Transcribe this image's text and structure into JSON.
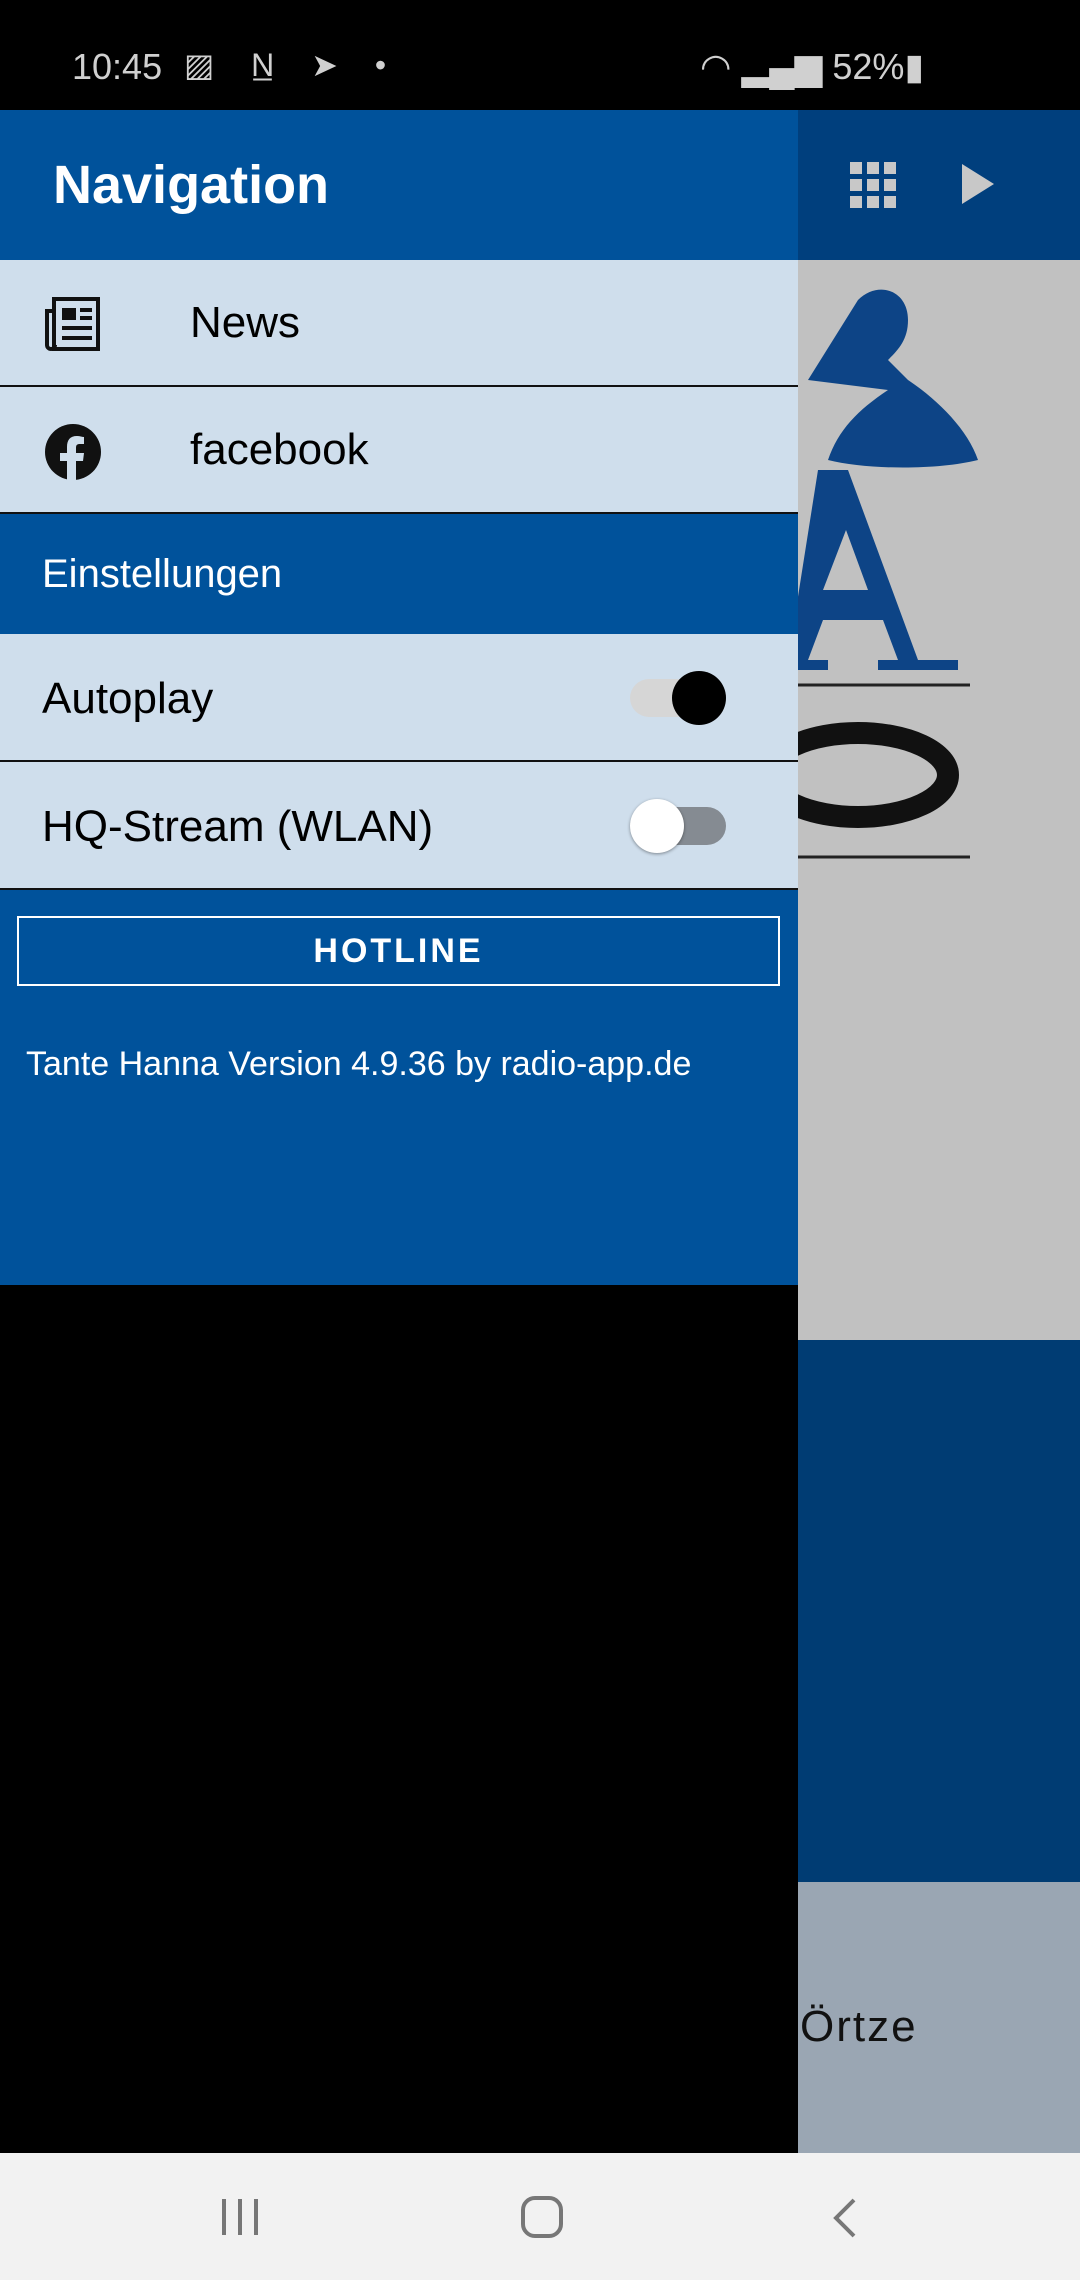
{
  "status_bar": {
    "time": "10:45",
    "notification_icons": [
      "image-icon",
      "notion-icon",
      "telegram-icon",
      "dot-icon"
    ],
    "battery": "52%"
  },
  "app_bar": {
    "icons": [
      "grid-icon",
      "play-icon"
    ]
  },
  "drawer": {
    "title": "Navigation",
    "items": [
      {
        "label": "News",
        "icon": "newspaper-icon"
      },
      {
        "label": "facebook",
        "icon": "facebook-icon"
      }
    ],
    "settings_header": "Einstellungen",
    "settings": [
      {
        "label": "Autoplay",
        "on": true
      },
      {
        "label": "HQ-Stream (WLAN)",
        "on": false
      }
    ],
    "hotline_label": "HOTLINE",
    "version_text": "Tante Hanna Version 4.9.36 by radio-app.de",
    "accent": "#00529b"
  },
  "background": {
    "partial_text": "Örtze"
  }
}
